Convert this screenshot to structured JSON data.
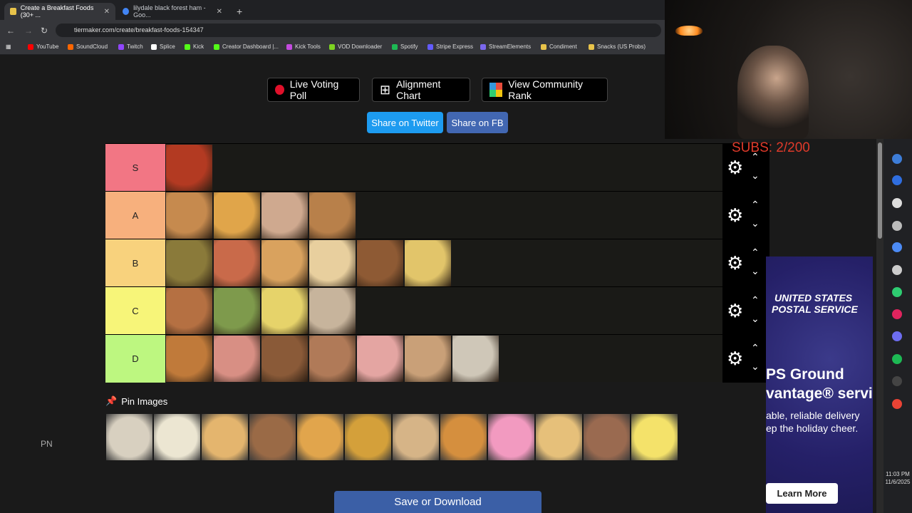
{
  "browser": {
    "tabs": [
      {
        "title": "Create a Breakfast Foods (30+ ...",
        "active": true
      },
      {
        "title": "lilydale black forest ham - Goo...",
        "active": false
      }
    ],
    "url": "tiermaker.com/create/breakfast-foods-154347",
    "bookmarks": [
      "YouTube",
      "SoundCloud",
      "Twitch",
      "Splice",
      "Kick",
      "Creator Dashboard |...",
      "Kick Tools",
      "VOD Downloader",
      "Spotify",
      "Stripe Express",
      "StreamElements",
      "Condiment",
      "Snacks (US Probs)"
    ]
  },
  "toolbar": {
    "live_poll": "Live Voting Poll",
    "alignment": "Alignment Chart",
    "community": "View Community Rank",
    "share_twitter": "Share on Twitter",
    "share_fb": "Share on FB"
  },
  "tiers": [
    {
      "label": "S",
      "color": "#f27684",
      "items": [
        "#b33a22"
      ]
    },
    {
      "label": "A",
      "color": "#f7b07d",
      "items": [
        "#c68a4e",
        "#e0a54a",
        "#cfa98f",
        "#b8804a"
      ]
    },
    {
      "label": "B",
      "color": "#f8d27d",
      "items": [
        "#8a7a3a",
        "#c96a4a",
        "#d9a25e",
        "#e8cf9e",
        "#8e5a34",
        "#e2c56a"
      ]
    },
    {
      "label": "C",
      "color": "#f7f579",
      "items": [
        "#b57042",
        "#7e9a4c",
        "#e6d36a",
        "#c7b49c"
      ]
    },
    {
      "label": "D",
      "color": "#bdf780",
      "items": [
        "#c07a3a",
        "#d88f84",
        "#8a5a38",
        "#b07a58",
        "#e4a5a2",
        "#c9a078",
        "#cfc7b8"
      ]
    }
  ],
  "pool": {
    "label": "Pin Images",
    "items": [
      "#d8d0c0",
      "#ece6d2",
      "#e4b56e",
      "#9a6a46",
      "#e1a54c",
      "#d4a03a",
      "#d6b487",
      "#d58f3e",
      "#f29ac0",
      "#e6c07a",
      "#9a6a50",
      "#f4e26a"
    ]
  },
  "pn_label": "PN",
  "save_label": "Save or Download",
  "stream": {
    "subs": "SUBS: 2/200",
    "time": "11:03 PM",
    "date": "11/6/2025"
  },
  "ad": {
    "brand_line1": "UNITED STATES",
    "brand_line2": "POSTAL SERVICE",
    "headline1": "PS Ground",
    "headline2": "vantage® servic",
    "body1": "able, reliable delivery",
    "body2": "ep the holiday cheer.",
    "cta": "Learn More"
  }
}
